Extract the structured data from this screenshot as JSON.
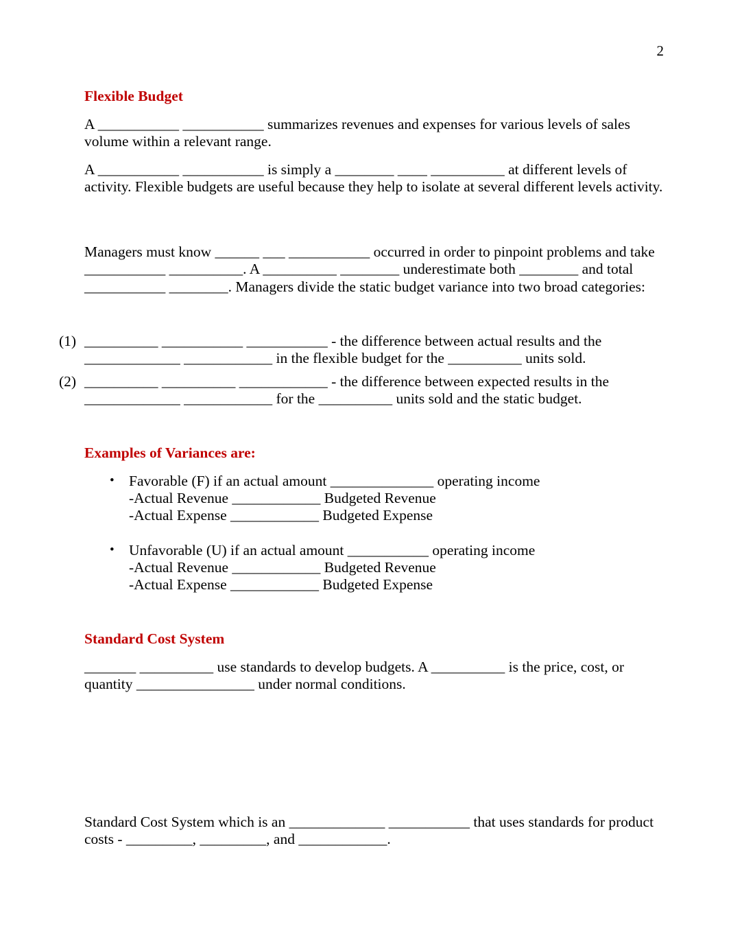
{
  "document": {
    "page_number": "2",
    "accent_color": "#C00000",
    "text_color": "#000000",
    "background_color": "#FFFFFF"
  },
  "sections": {
    "flexible_budget": {
      "heading": "Flexible Budget",
      "paragraph_1": "A ___________ ___________ summarizes revenues and expenses for various levels of sales volume within a relevant range.",
      "paragraph_2": "A ___________ ___________ is simply a ________ ____ __________ at different levels of activity. Flexible budgets are useful because they help to isolate at several different levels activity.",
      "paragraph_3": "Managers must know ______ ___ ___________ occurred in order to pinpoint problems and take ___________ __________. A __________ ________ underestimate both ________ and total ___________ ________. Managers divide the static budget variance into two broad categories:"
    },
    "categories_list": [
      {
        "marker": "(1)",
        "text": "__________ ___________ ___________ - the difference between actual results and the _____________ ____________ in the flexible budget for the __________ units sold."
      },
      {
        "marker": "(2)",
        "text": "__________ __________ ____________ - the difference between expected results in the _____________ ____________ for the __________ units sold and the static budget."
      }
    ],
    "variances": {
      "heading": "Examples of Variances are:",
      "bullet_glyph": "•",
      "items": [
        {
          "main": "Favorable (F) if an actual amount ______________ operating income",
          "line_2": "-Actual Revenue ____________ Budgeted Revenue",
          "line_3": "-Actual Expense ____________ Budgeted Expense"
        },
        {
          "main": "Unfavorable (U) if an actual amount ___________ operating income",
          "line_2": "-Actual Revenue ____________ Budgeted Revenue",
          "line_3": "-Actual Expense ____________ Budgeted Expense"
        }
      ]
    },
    "standard_cost_system": {
      "heading": "Standard Cost System",
      "paragraph_1": "_______ __________ use standards to develop budgets. A __________ is the price, cost, or quantity ________________ under normal conditions.",
      "paragraph_2": "Standard Cost System which is an _____________ ___________ that uses standards for product costs - _________, _________, and ____________."
    }
  }
}
